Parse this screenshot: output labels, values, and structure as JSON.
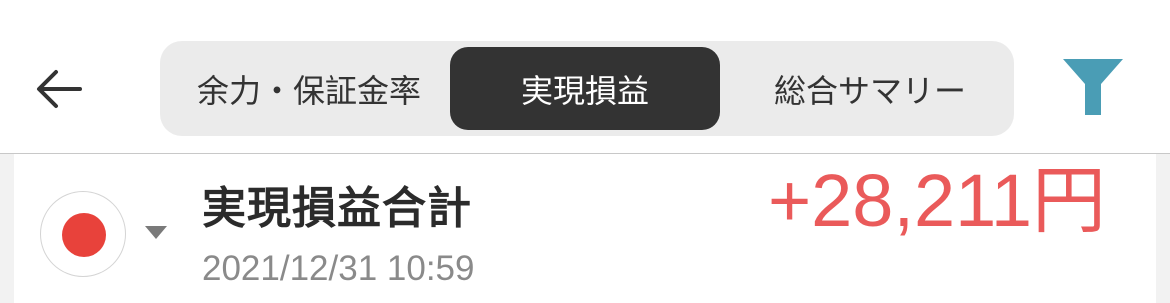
{
  "header": {
    "back_icon": "arrow-left-icon",
    "tabs": [
      {
        "label": "余力・保証金率",
        "active": false
      },
      {
        "label": "実現損益",
        "active": true
      },
      {
        "label": "総合サマリー",
        "active": false
      }
    ],
    "filter_icon": "filter-icon",
    "filter_color": "#4a9db5"
  },
  "summary": {
    "market_icon": "japan-flag-icon",
    "title": "実現損益合計",
    "timestamp": "2021/12/31 10:59",
    "amount": "+28,211円",
    "amount_color": "#ea5a5a"
  }
}
